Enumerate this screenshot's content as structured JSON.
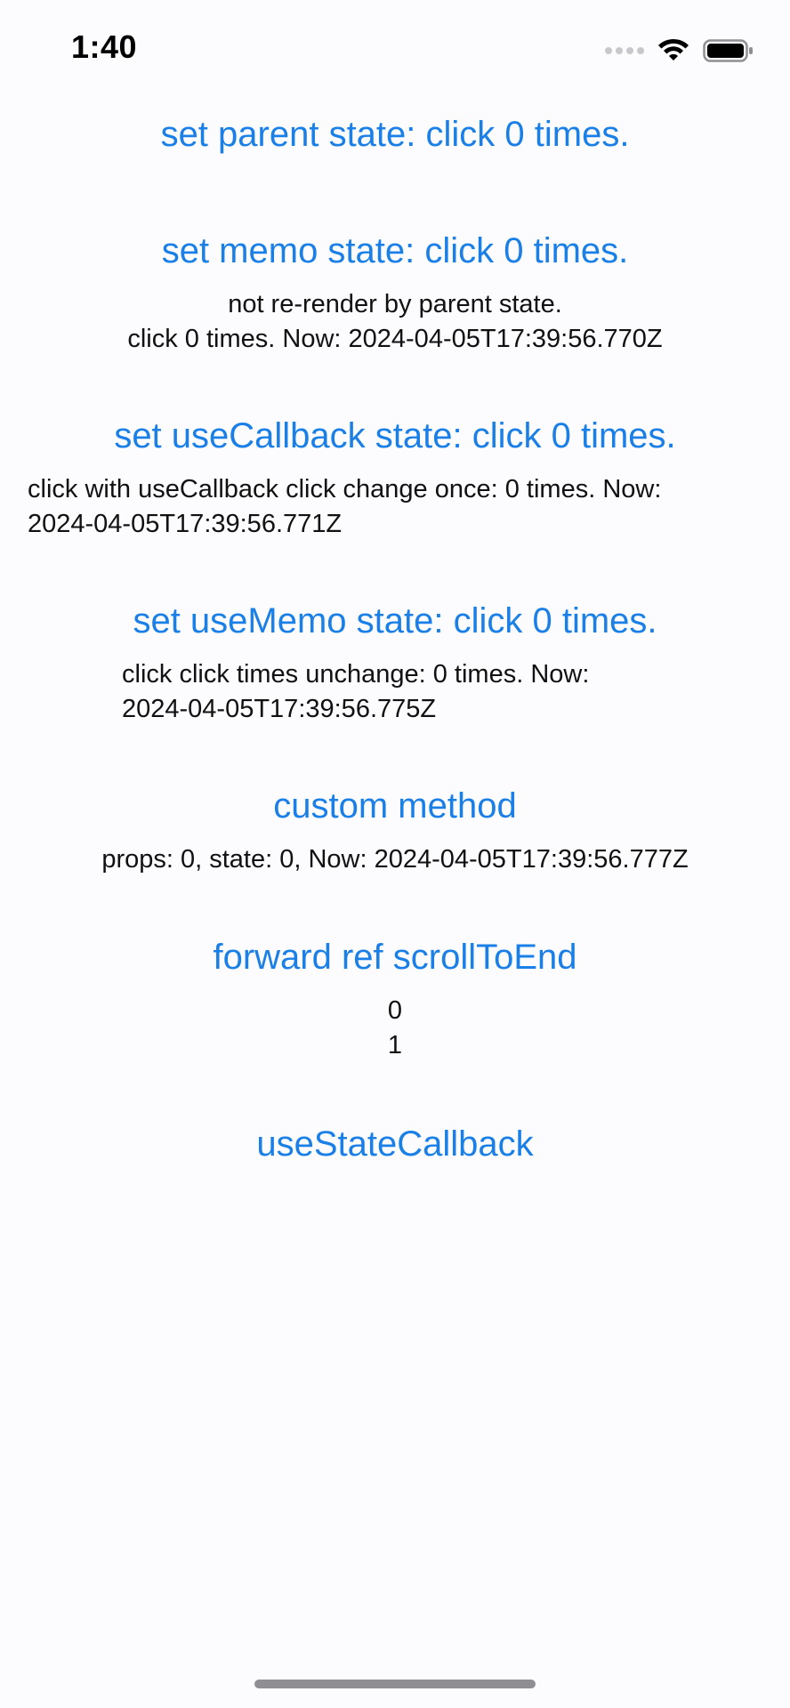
{
  "status_bar": {
    "time": "1:40",
    "icons": [
      "cellular-signal-icon",
      "wifi-icon",
      "battery-icon"
    ]
  },
  "buttons": {
    "parent_state": "set parent state: click 0 times.",
    "memo_state": "set memo state: click 0 times.",
    "use_callback_state": "set useCallback state: click 0 times.",
    "use_memo_state": "set useMemo state: click 0 times.",
    "custom_method": "custom method",
    "forward_ref": "forward ref scrollToEnd",
    "use_state_callback": "useStateCallback"
  },
  "texts": {
    "memo_line1": "not re-render by parent state.",
    "memo_line2": "click 0 times. Now: 2024-04-05T17:39:56.770Z",
    "callback_line1": "click with useCallback click change once: 0 times. Now:",
    "callback_line2": "2024-04-05T17:39:56.771Z",
    "usememo_line1": "click click times unchange: 0 times. Now:",
    "usememo_line2": "2024-04-05T17:39:56.775Z",
    "custom_line": "props: 0, state: 0, Now: 2024-04-05T17:39:56.777Z",
    "forward_items": [
      "0",
      "1"
    ]
  },
  "colors": {
    "accent": "#1a7fe6",
    "background": "#fcfcfe",
    "text": "#111111"
  }
}
